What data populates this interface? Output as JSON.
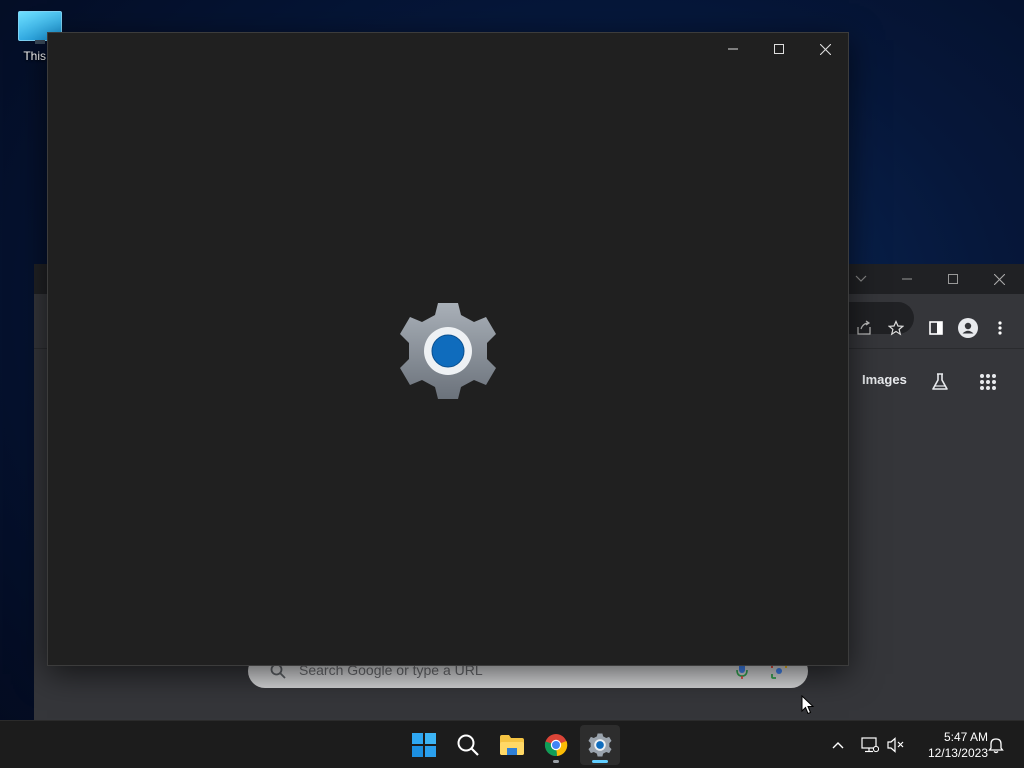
{
  "desktop": {
    "icons": [
      {
        "label": "This F",
        "icon": "computer-icon"
      }
    ]
  },
  "browser": {
    "toolbar_icons": [
      "share-icon",
      "star-icon",
      "side-panel-icon",
      "profile-icon",
      "menu-dots-icon"
    ],
    "images_link": "Images",
    "labs_icon": "flask-icon",
    "apps_icon": "apps-grid-icon",
    "search_placeholder": "Search Google or type a URL",
    "window_controls": [
      "chevron-down-icon",
      "minimize-icon",
      "maximize-icon",
      "close-icon"
    ]
  },
  "settings_window": {
    "app_icon": "settings-gear-icon",
    "caption_buttons": [
      "minimize-icon",
      "maximize-icon",
      "close-icon"
    ]
  },
  "taskbar": {
    "apps": [
      "start-icon",
      "search-icon",
      "file-explorer-icon",
      "chrome-icon",
      "settings-icon"
    ],
    "active_app": "settings-icon",
    "tray_icons": [
      "chevron-up-icon",
      "network-icon",
      "volume-muted-icon",
      "notification-bell-icon"
    ],
    "time": "5:47 AM",
    "date": "12/13/2023"
  },
  "colors": {
    "accent": "#0f6cbd",
    "settings_bg": "#202020",
    "browser_bg": "#35363a",
    "taskbar_bg": "#1c1c1c"
  }
}
